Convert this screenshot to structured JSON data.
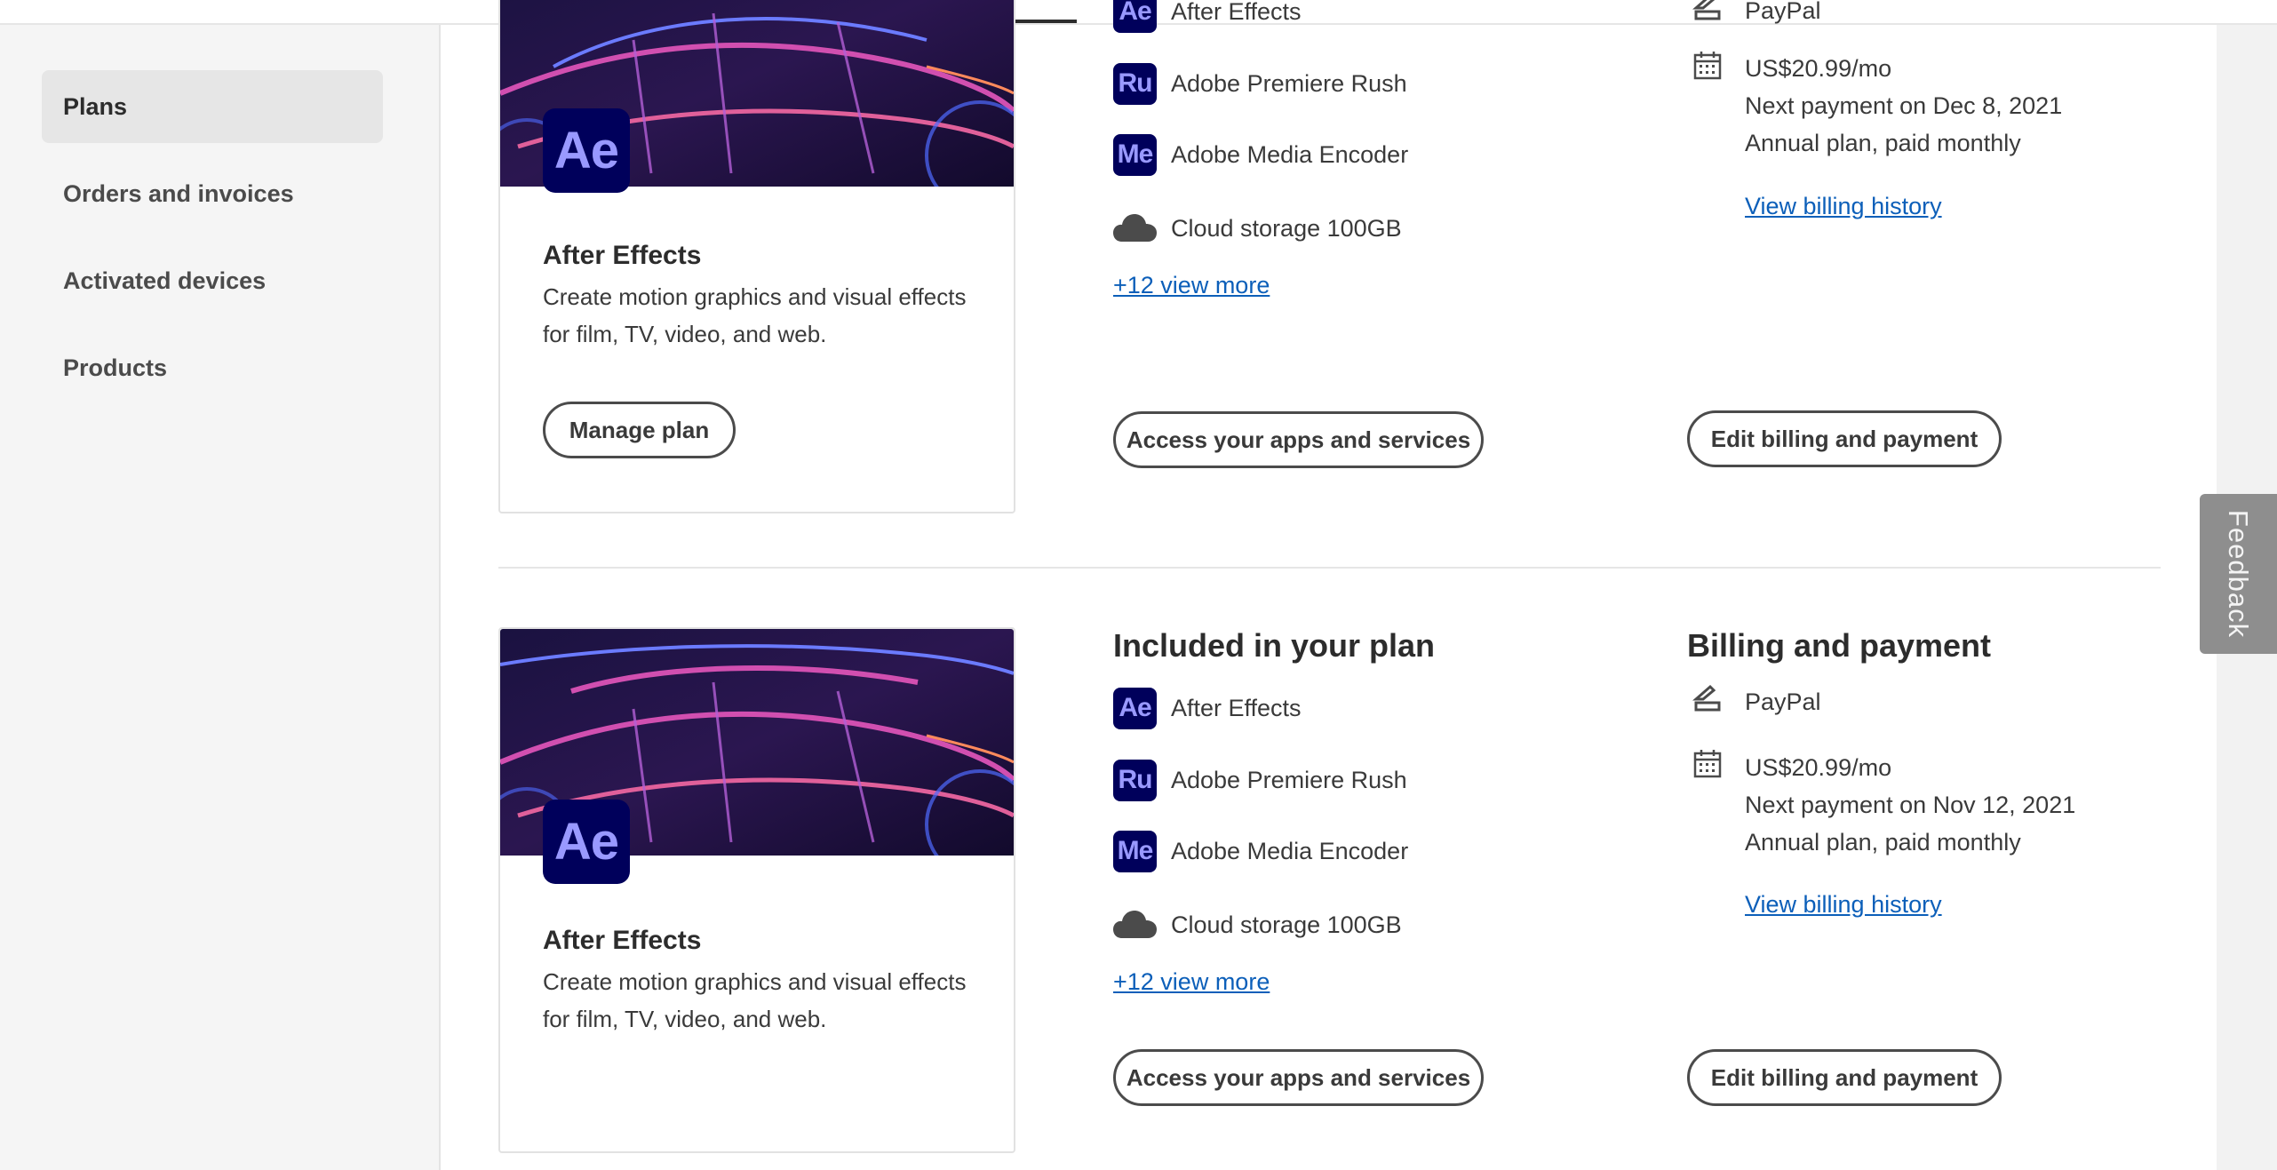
{
  "sidebar": {
    "items": [
      {
        "label": "Plans",
        "active": true
      },
      {
        "label": "Orders and invoices",
        "active": false
      },
      {
        "label": "Activated devices",
        "active": false
      },
      {
        "label": "Products",
        "active": false
      }
    ]
  },
  "feedback": {
    "label": "Feedback"
  },
  "colors": {
    "app_icon_bg": "#00005b",
    "app_icon_text": "#9999ff",
    "link": "#0c5fb9"
  },
  "plans": [
    {
      "product": {
        "logo_text": "Ae",
        "title": "After Effects",
        "description": "Create motion graphics and visual effects for film, TV, video, and web.",
        "manage_label": "Manage plan"
      },
      "included": {
        "heading": "",
        "apps": [
          {
            "icon": "Ae",
            "name": "After Effects"
          },
          {
            "icon": "Ru",
            "name": "Adobe Premiere Rush"
          },
          {
            "icon": "Me",
            "name": "Adobe Media Encoder"
          }
        ],
        "storage_label": "Cloud storage 100GB",
        "view_more": "+12 view more",
        "access_label": "Access your apps and services"
      },
      "billing": {
        "heading": "",
        "method": "PayPal",
        "price": "US$20.99/mo",
        "next_payment": "Next payment on Dec 8, 2021",
        "plan_type": "Annual plan, paid monthly",
        "history_link": "View billing history",
        "edit_label": "Edit billing and payment"
      }
    },
    {
      "product": {
        "logo_text": "Ae",
        "title": "After Effects",
        "description": "Create motion graphics and visual effects for film, TV, video, and web.",
        "manage_label": ""
      },
      "included": {
        "heading": "Included in your plan",
        "apps": [
          {
            "icon": "Ae",
            "name": "After Effects"
          },
          {
            "icon": "Ru",
            "name": "Adobe Premiere Rush"
          },
          {
            "icon": "Me",
            "name": "Adobe Media Encoder"
          }
        ],
        "storage_label": "Cloud storage 100GB",
        "view_more": "+12 view more",
        "access_label": "Access your apps and services"
      },
      "billing": {
        "heading": "Billing and payment",
        "method": "PayPal",
        "price": "US$20.99/mo",
        "next_payment": "Next payment on Nov 12, 2021",
        "plan_type": "Annual plan, paid monthly",
        "history_link": "View billing history",
        "edit_label": "Edit billing and payment"
      }
    }
  ]
}
